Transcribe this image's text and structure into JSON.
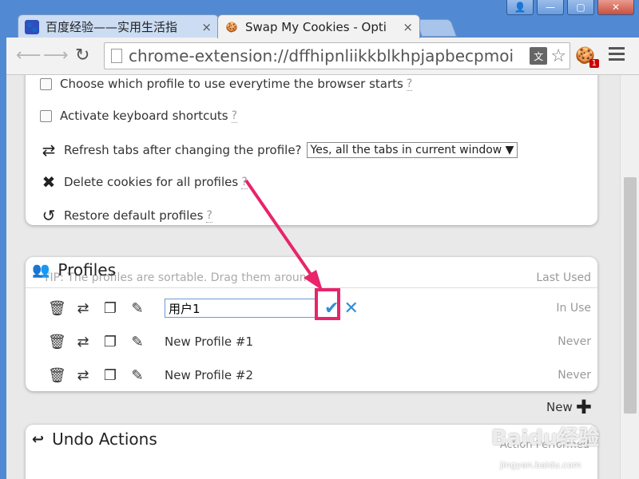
{
  "window": {
    "controls": [
      "👤",
      "—",
      "▢",
      "✕"
    ]
  },
  "tabs": [
    {
      "title": "百度经验——实用生活指",
      "close": "×"
    },
    {
      "title": "Swap My Cookies - Opti",
      "close": "×"
    }
  ],
  "toolbar": {
    "url": "chrome-extension://dffhipnliikkblkhpjapbecpmoi",
    "extension_badge": "1"
  },
  "options": {
    "choose_profile": "Choose which profile to use everytime the browser starts",
    "keyboard_shortcuts": "Activate keyboard shortcuts",
    "refresh_tabs": "Refresh tabs after changing the profile?",
    "refresh_select": "Yes, all the tabs in current window ▼",
    "delete_cookies": "Delete cookies for all profiles",
    "restore_profiles": "Restore default profiles",
    "help": "?"
  },
  "profiles": {
    "title": "Profiles",
    "tip": "TIP: The profiles are sortable. Drag them around!",
    "last_used_header": "Last Used",
    "editing_value": "用户1",
    "rows": [
      {
        "name": "用户1",
        "status": "In Use"
      },
      {
        "name": "New Profile #1",
        "status": "Never"
      },
      {
        "name": "New Profile #2",
        "status": "Never"
      }
    ],
    "new_label": "New"
  },
  "undo": {
    "title": "Undo Actions",
    "action_performed": "Action Performed"
  },
  "watermark": {
    "logo": "Baidu经验",
    "sub": "jingyan.baidu.com"
  },
  "colors": {
    "highlight": "#e8246a",
    "accent": "#2f8ed8"
  }
}
